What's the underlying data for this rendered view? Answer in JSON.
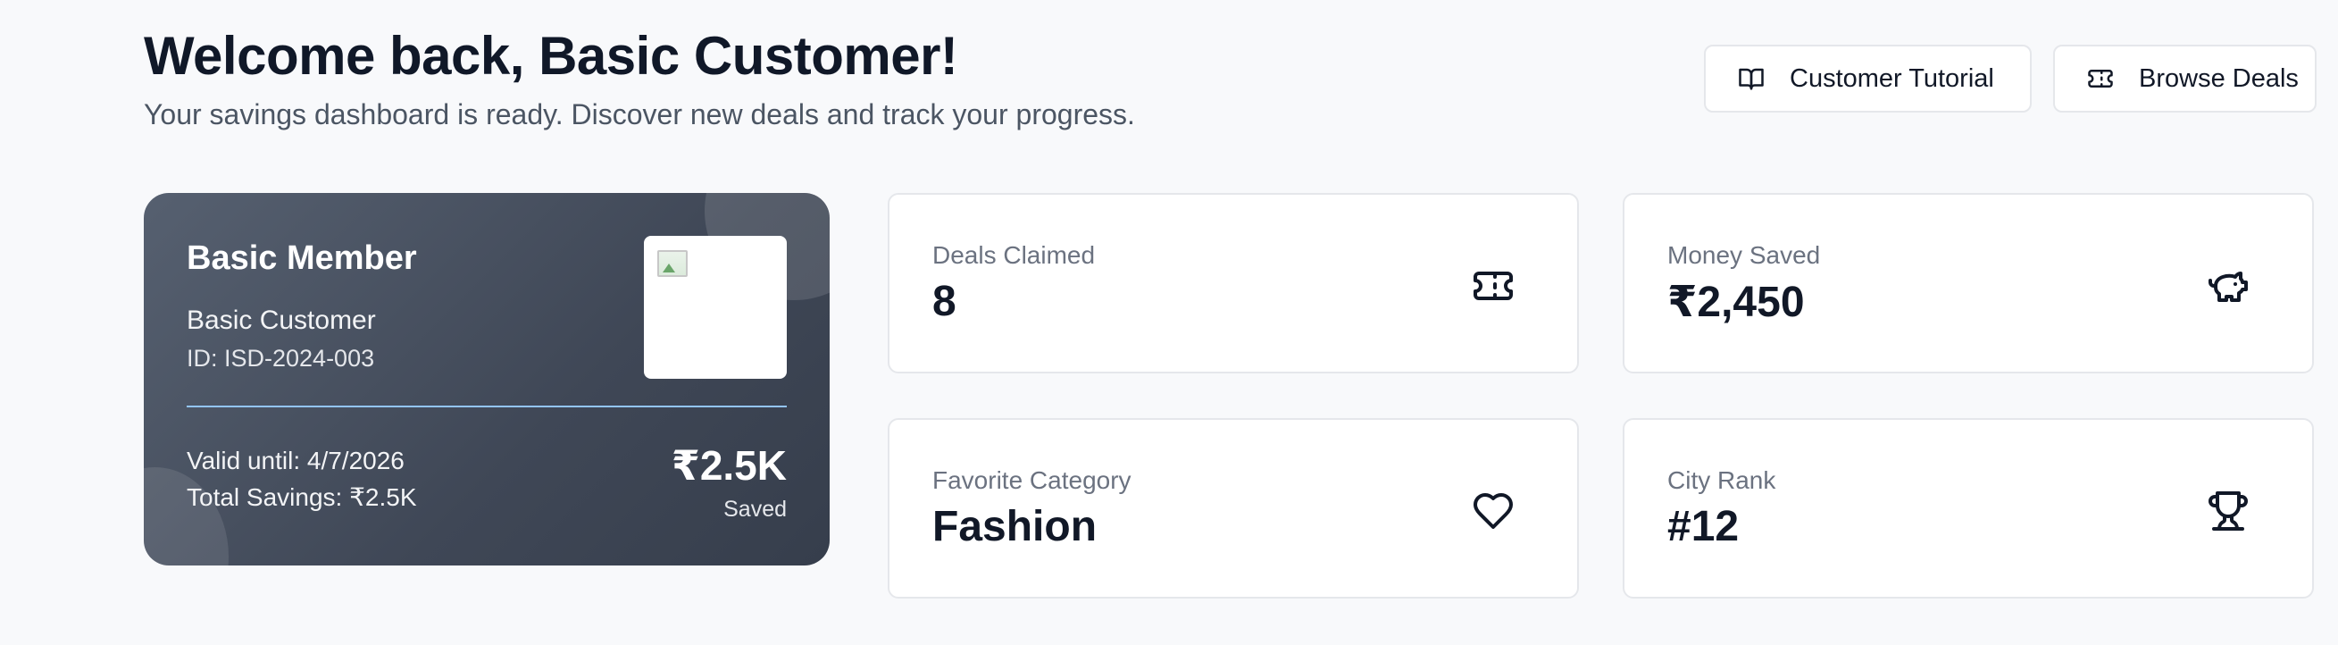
{
  "header": {
    "title": "Welcome back, Basic Customer!",
    "subtitle": "Your savings dashboard is ready. Discover new deals and track your progress."
  },
  "actions": {
    "tutorial_label": "Customer Tutorial",
    "tutorial_icon": "book-open-icon",
    "deals_label": "Browse Deals",
    "deals_icon": "ticket-icon"
  },
  "member_card": {
    "tier": "Basic Member",
    "name": "Basic Customer",
    "id": "ID: ISD-2024-003",
    "valid_until": "Valid until: 4/7/2026",
    "total_savings": "Total Savings: ₹2.5K",
    "saved_amount": "₹2.5K",
    "saved_label": "Saved",
    "qr_image": "broken-image-icon",
    "divider_color": "#93c5fd"
  },
  "stats": {
    "deals_claimed": {
      "label": "Deals Claimed",
      "value": "8",
      "icon": "ticket-icon"
    },
    "money_saved": {
      "label": "Money Saved",
      "value": "₹2,450",
      "icon": "piggy-bank-icon"
    },
    "favorite_category": {
      "label": "Favorite Category",
      "value": "Fashion",
      "icon": "heart-icon"
    },
    "city_rank": {
      "label": "City Rank",
      "value": "#12",
      "icon": "trophy-icon"
    }
  },
  "colors": {
    "background": "#f8f9fb",
    "card_gradient_start": "#566070",
    "card_gradient_end": "#363e4c",
    "text_primary": "#111827",
    "text_muted": "#6b7280"
  }
}
